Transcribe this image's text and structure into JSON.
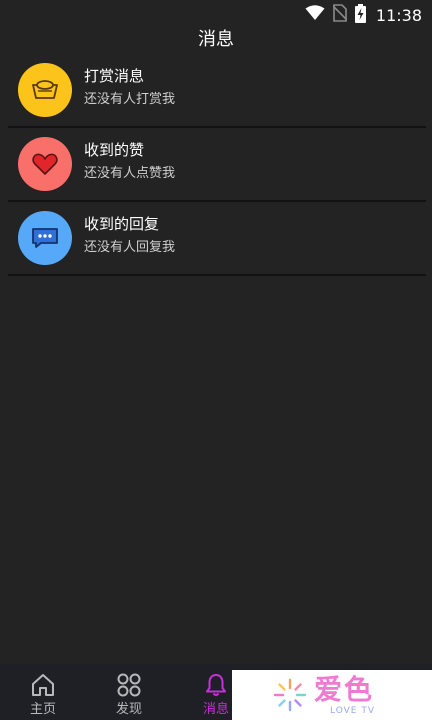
{
  "status_bar": {
    "time": "11:38",
    "icons": [
      "wifi-icon",
      "no-sim-icon",
      "battery-charging-icon"
    ]
  },
  "header": {
    "title": "消息"
  },
  "messages": [
    {
      "title": "打赏消息",
      "subtitle": "还没有人打赏我",
      "icon": "gold-ingot-icon",
      "color": "#fcc31a"
    },
    {
      "title": "收到的赞",
      "subtitle": "还没有人点赞我",
      "icon": "heart-icon",
      "color": "#f9706b"
    },
    {
      "title": "收到的回复",
      "subtitle": "还没有人回复我",
      "icon": "chat-bubble-icon",
      "color": "#56a8f9"
    }
  ],
  "bottom_nav": {
    "items": [
      {
        "label": "主页",
        "icon": "home-icon",
        "active": false
      },
      {
        "label": "发现",
        "icon": "discover-icon",
        "active": false
      },
      {
        "label": "消息",
        "icon": "bell-icon",
        "active": true
      }
    ],
    "active_color": "#c530d7"
  },
  "watermark": {
    "brand": "爱色",
    "sub": "LOVE TV"
  }
}
